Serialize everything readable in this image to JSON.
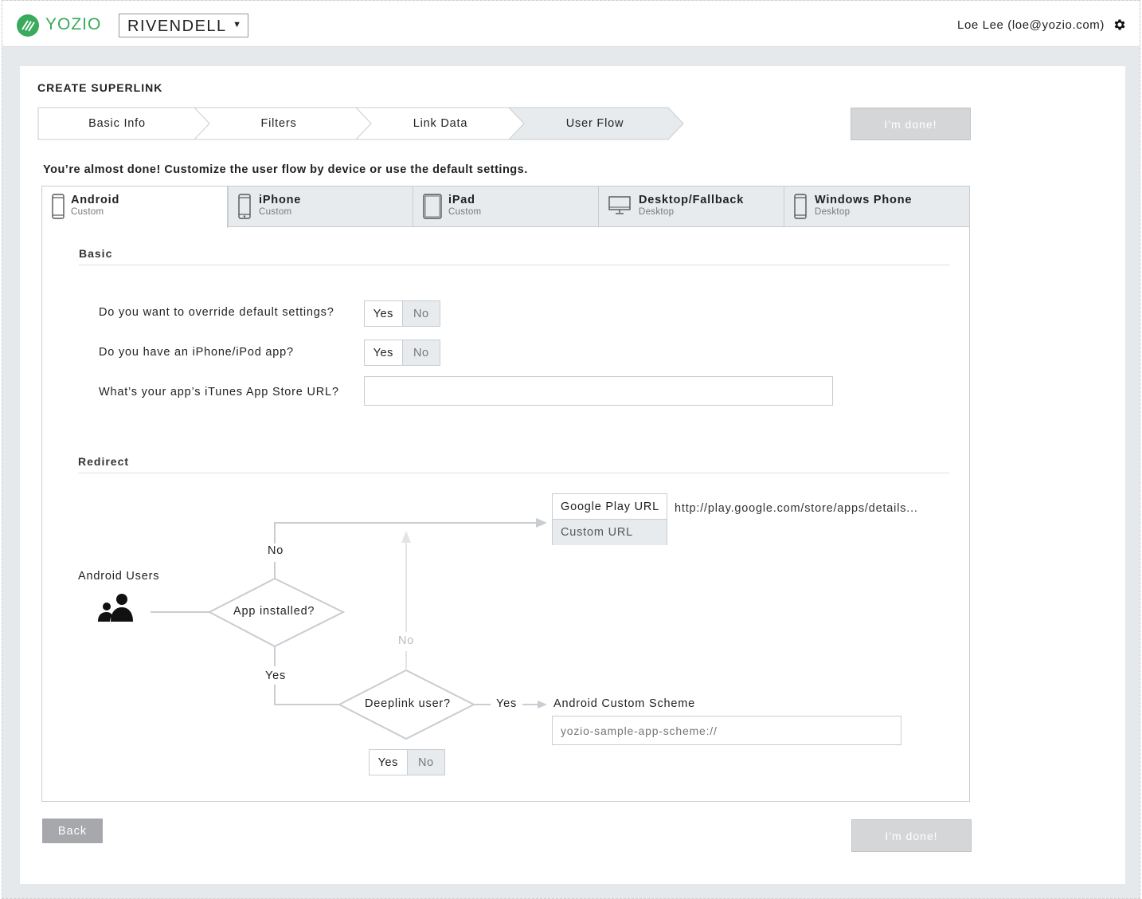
{
  "header": {
    "logo_text": "YOZIO",
    "org_name": "RIVENDELL",
    "user": "Loe Lee (loe@yozio.com)"
  },
  "page": {
    "title": "CREATE SUPERLINK",
    "done_label": "I'm done!",
    "intro": "You’re almost done! Customize the user flow by device or use the default settings.",
    "back_label": "Back"
  },
  "steps": [
    "Basic Info",
    "Filters",
    "Link Data",
    "User Flow"
  ],
  "active_step": "User Flow",
  "tabs": [
    {
      "name": "Android",
      "sub": "Custom"
    },
    {
      "name": "iPhone",
      "sub": "Custom"
    },
    {
      "name": "iPad",
      "sub": "Custom"
    },
    {
      "name": "Desktop/Fallback",
      "sub": "Desktop"
    },
    {
      "name": "Windows Phone",
      "sub": "Desktop"
    }
  ],
  "active_tab": "Android",
  "basic": {
    "title": "Basic",
    "q1": "Do you want to override default settings?",
    "q2": "Do you have an iPhone/iPod app?",
    "q3": "What’s your app’s iTunes App Store URL?",
    "q3_value": "",
    "yes": "Yes",
    "no": "No"
  },
  "redirect": {
    "title": "Redirect",
    "users_label": "Android Users",
    "app_installed": "App installed?",
    "deeplink_user": "Deeplink user?",
    "no": "No",
    "yes": "Yes",
    "google_play_url": "Google Play URL",
    "custom_url": "Custom URL",
    "play_url_value": "http://play.google.com/store/apps/details...",
    "custom_scheme_label": "Android Custom Scheme",
    "custom_scheme_placeholder": "yozio-sample-app-scheme://"
  },
  "colors": {
    "brand_green": "#3aaa5c",
    "disabled_button": "#d4d6d8",
    "tab_inactive": "#e8ebee"
  }
}
